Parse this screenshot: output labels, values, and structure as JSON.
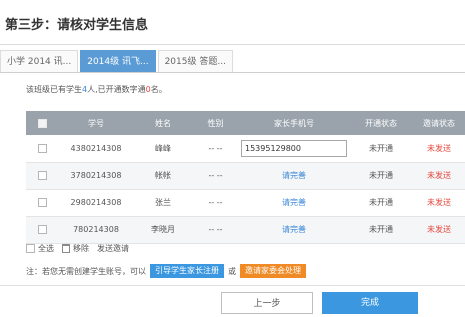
{
  "header": {
    "title": "第三步：请核对学生信息"
  },
  "tabs": [
    {
      "label": "小学 2014 讯...",
      "active": false
    },
    {
      "label": "2014级 讯飞...",
      "active": true
    },
    {
      "label": "2015级 答题...",
      "active": false
    }
  ],
  "summary": {
    "prefix": "该班级已有学生",
    "student_count": "4",
    "middle": "人,已开通数字通",
    "opened_count": "0",
    "suffix": "名。"
  },
  "table": {
    "columns": [
      "学号",
      "姓名",
      "性别",
      "家长手机号",
      "开通状态",
      "邀请状态"
    ],
    "rows": [
      {
        "id": "4380214308",
        "name": "峰峰",
        "gender": "-- --",
        "phone": "15395129800",
        "phone_is_input": true,
        "open_status": "未开通",
        "invite_status": "未发送"
      },
      {
        "id": "3780214308",
        "name": "帐帐",
        "gender": "-- --",
        "phone": "请完善",
        "phone_is_input": false,
        "open_status": "未开通",
        "invite_status": "未发送"
      },
      {
        "id": "2980214308",
        "name": "张兰",
        "gender": "-- --",
        "phone": "请完善",
        "phone_is_input": false,
        "open_status": "未开通",
        "invite_status": "未发送"
      },
      {
        "id": "780214308",
        "name": "李晓月",
        "gender": "-- --",
        "phone": "请完善",
        "phone_is_input": false,
        "open_status": "未开通",
        "invite_status": "未发送"
      }
    ]
  },
  "actions": {
    "select_all": "全选",
    "remove": "移除",
    "send_invite": "发送邀请"
  },
  "note": {
    "prefix": "注：若您无需创建学生账号，可以",
    "guide_button": "引导学生家长注册",
    "or": "或",
    "committee_button": "邀请家委会处理"
  },
  "footer": {
    "prev": "上一步",
    "done": "完成"
  },
  "colors": {
    "accent": "#3a97e0",
    "tab_active": "#5b9bd5",
    "header_row": "#9aa3ac",
    "danger": "#e8473c",
    "orange": "#f08a24"
  }
}
